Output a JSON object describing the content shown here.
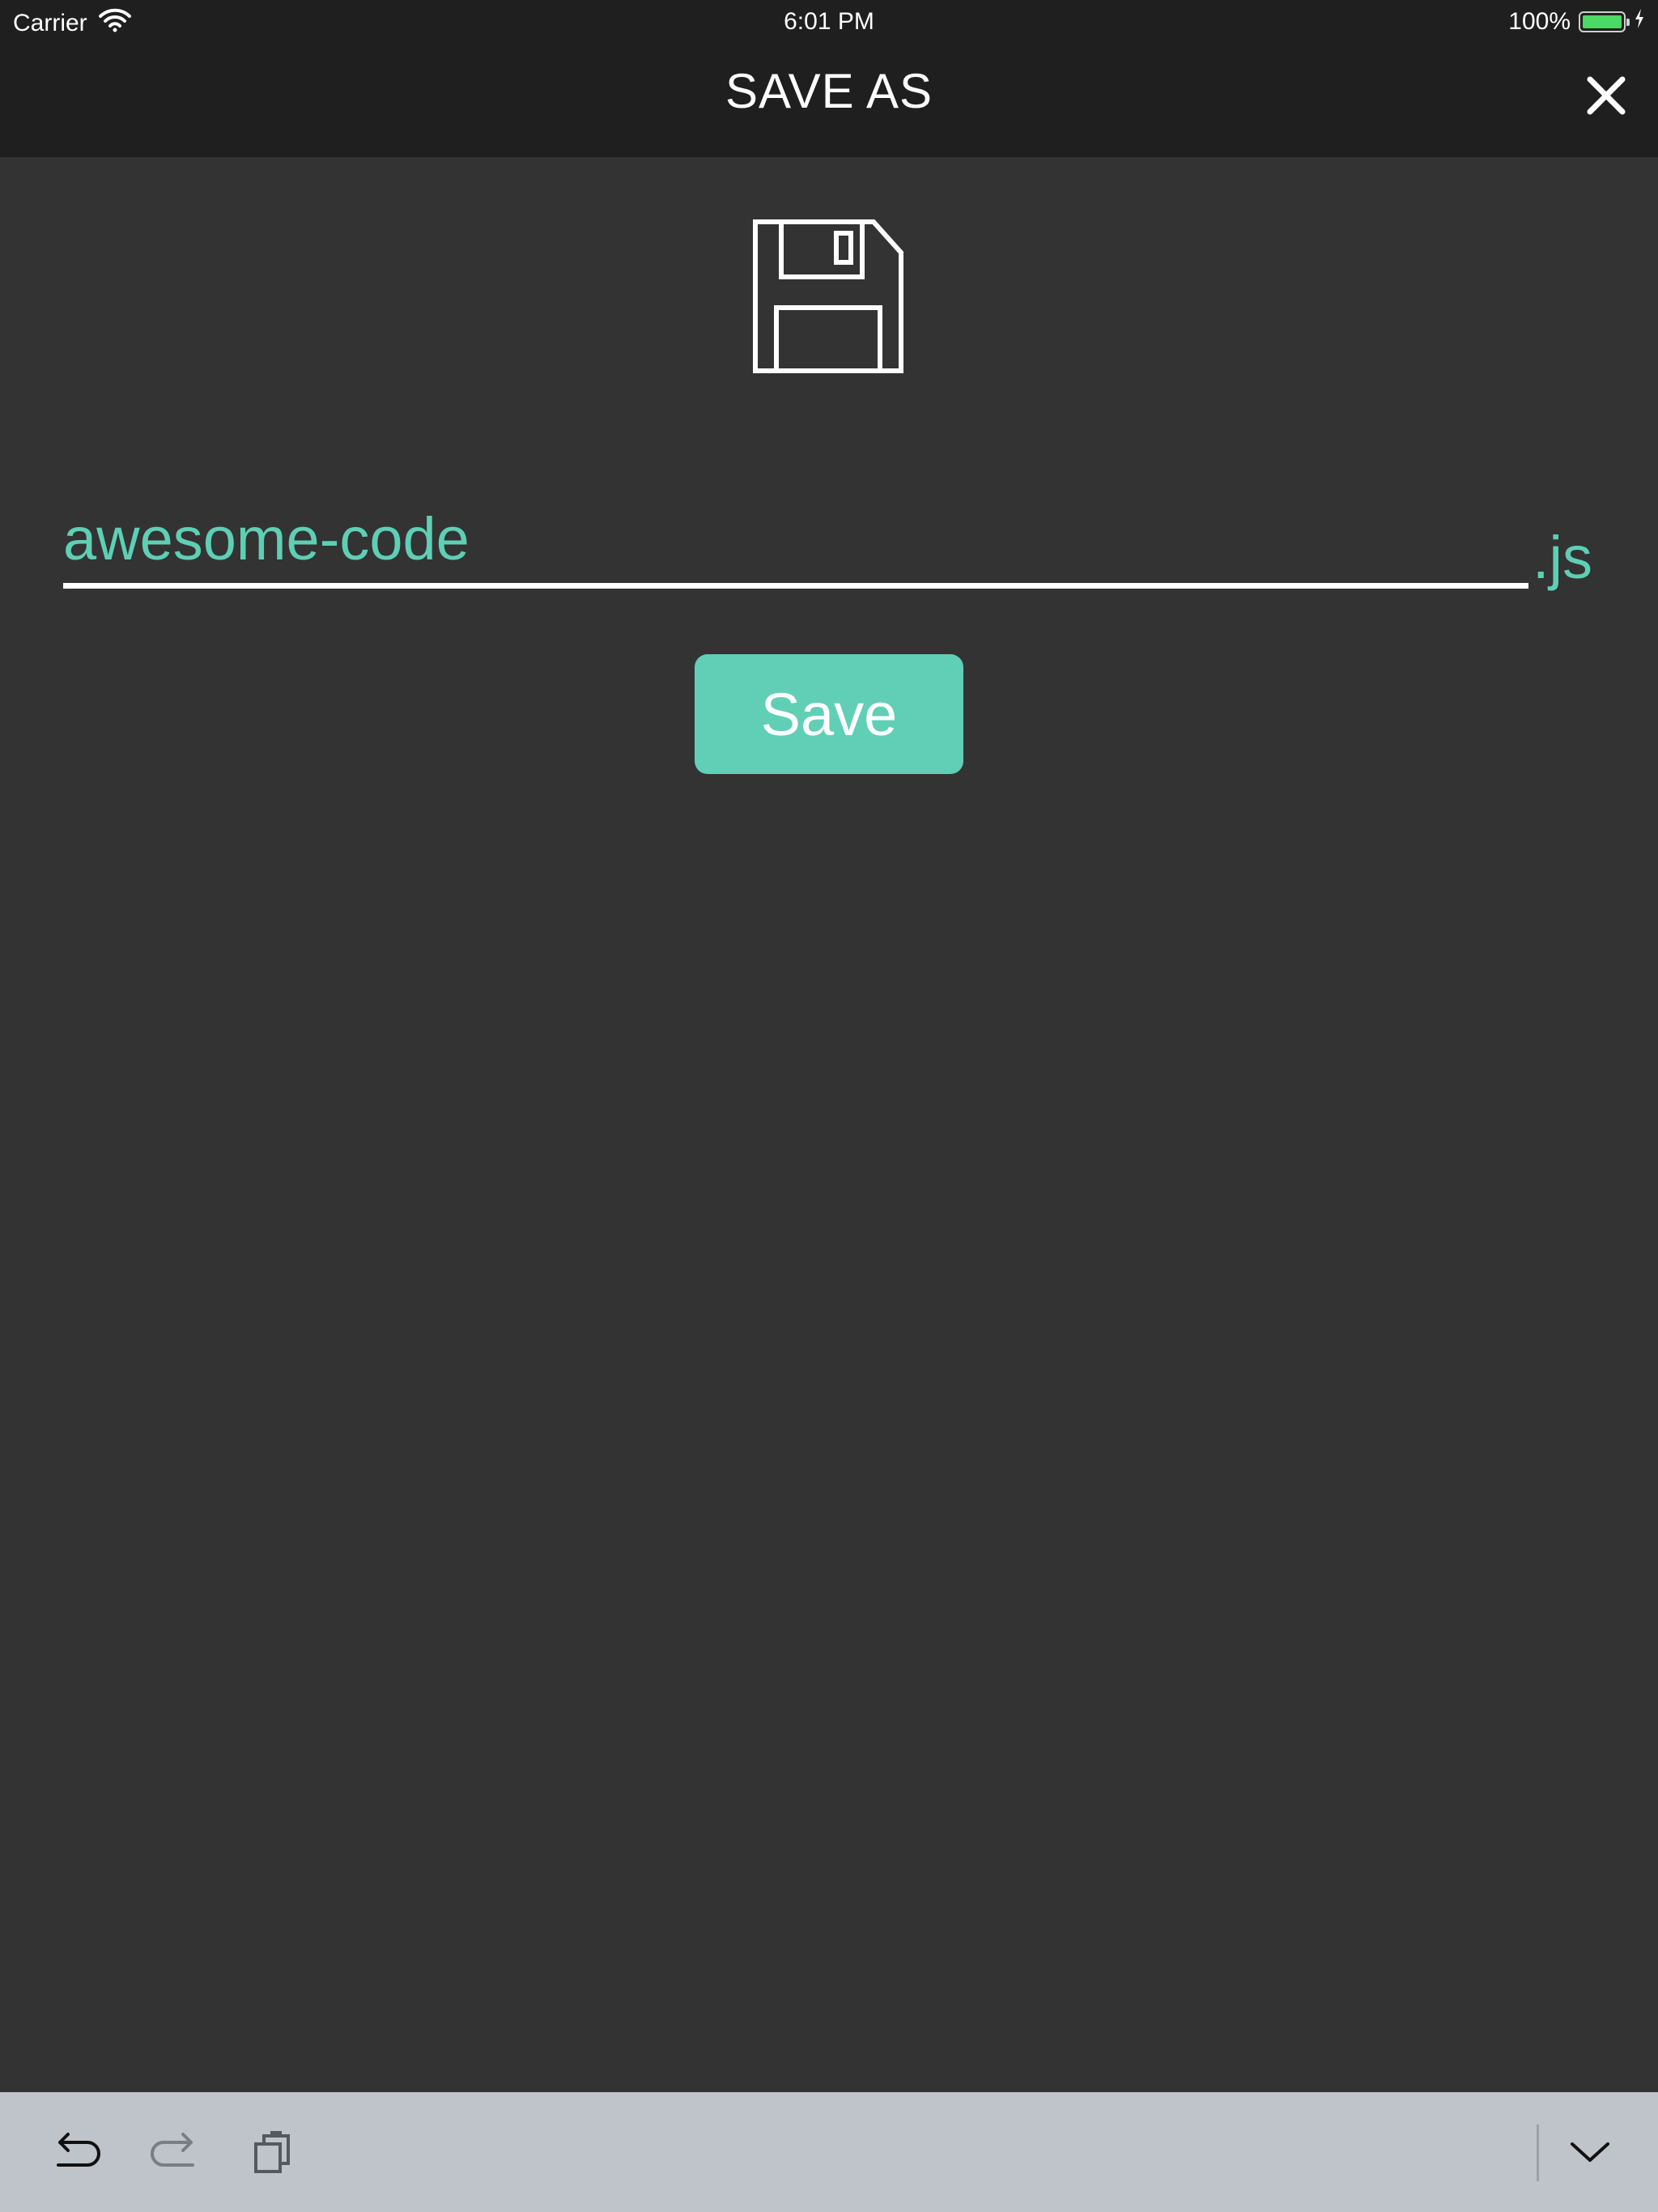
{
  "status_bar": {
    "carrier": "Carrier",
    "time": "6:01 PM",
    "battery_percent": "100%",
    "battery_level": 1.0
  },
  "nav": {
    "title": "SAVE AS",
    "close_icon": "close-icon"
  },
  "form": {
    "filename_value": "awesome-code",
    "extension": ".js",
    "save_label": "Save",
    "save_icon": "floppy-disk-icon"
  },
  "accessory_bar": {
    "items": [
      "undo-icon",
      "redo-icon",
      "paste-icon",
      "dismiss-keyboard-icon"
    ]
  },
  "colors": {
    "accent": "#60cfb6",
    "background": "#333333",
    "bar": "#1f1f1f",
    "accessory": "#bfc4cb"
  }
}
